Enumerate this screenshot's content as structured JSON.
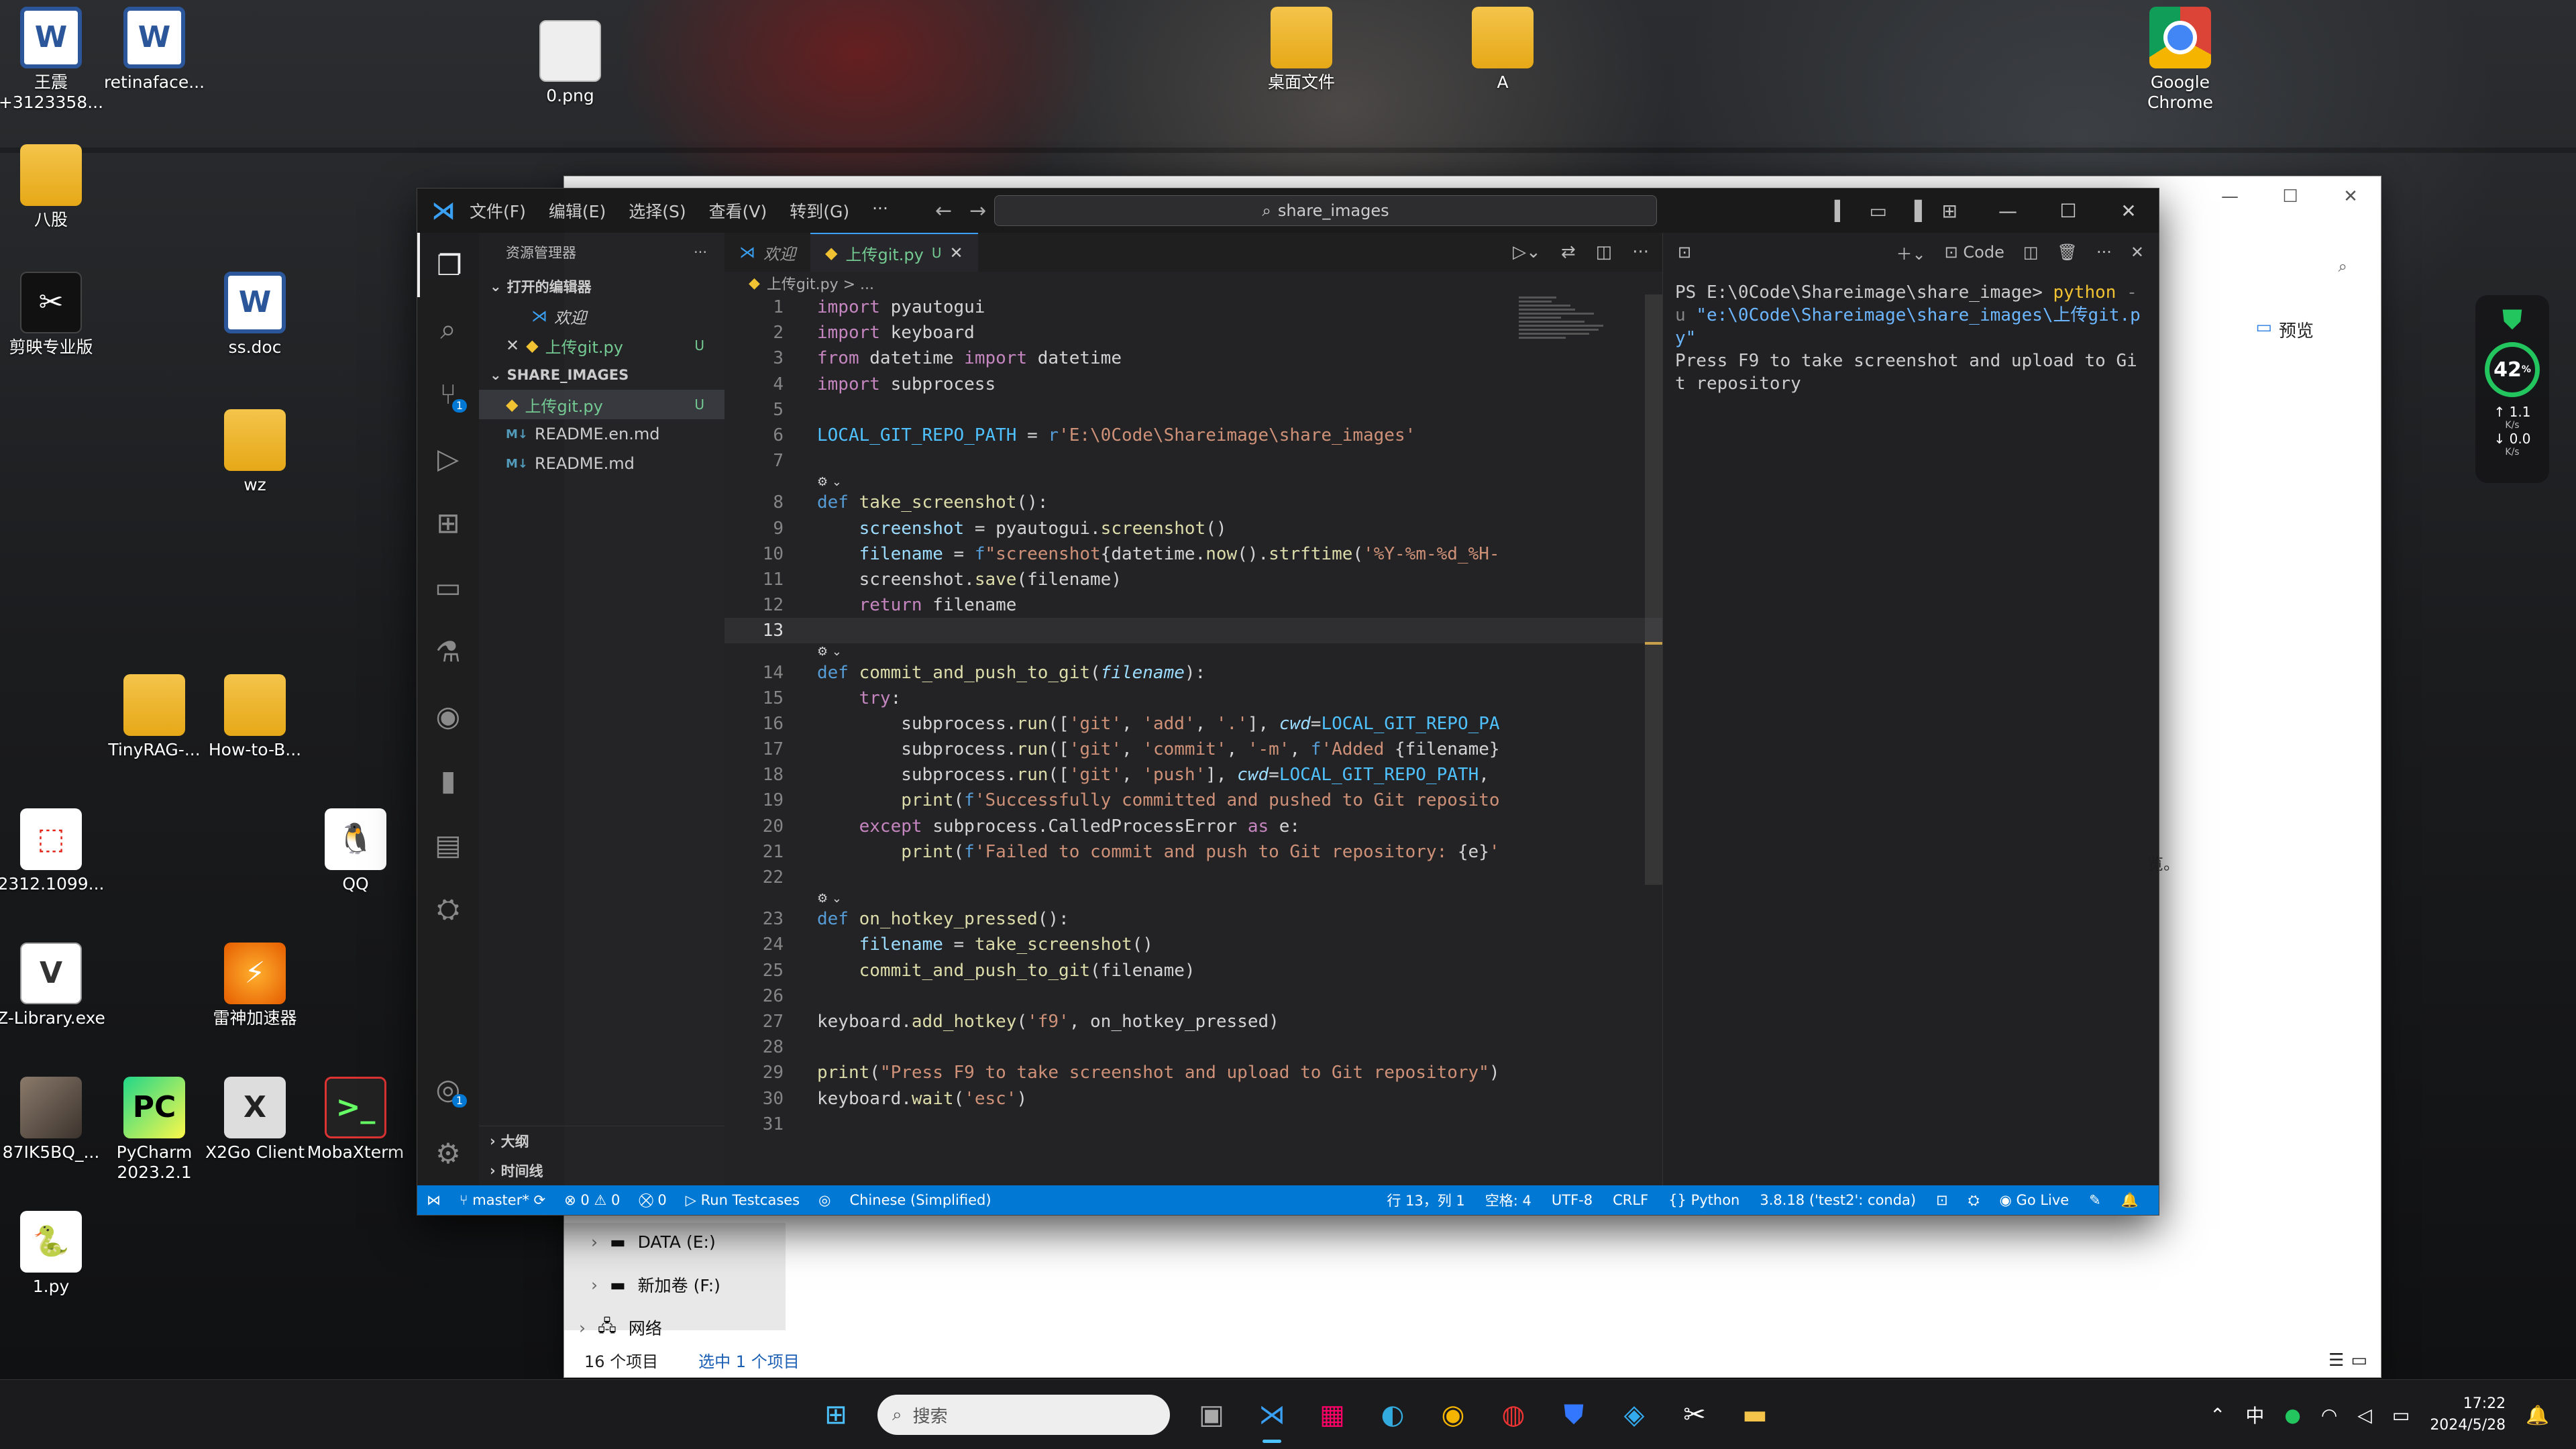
{
  "desktop": {
    "icons": [
      {
        "label": "王震\n+3123358...",
        "glyph": "W",
        "kind": "g-word"
      },
      {
        "label": "retinaface...",
        "glyph": "W",
        "kind": "g-word"
      },
      {
        "label": "0.png",
        "glyph": "",
        "kind": "g-img"
      },
      {
        "label": "桌面文件",
        "glyph": "",
        "kind": "g-folder"
      },
      {
        "label": "A",
        "glyph": "",
        "kind": "g-folder"
      },
      {
        "label": "Google\nChrome",
        "glyph": "",
        "kind": "g-chrome"
      },
      {
        "label": "八股",
        "glyph": "",
        "kind": "g-folder"
      },
      {
        "label": "剪映专业版",
        "glyph": "✂",
        "kind": "g-capcut"
      },
      {
        "label": "ss.doc",
        "glyph": "W",
        "kind": "g-word"
      },
      {
        "label": "wz",
        "glyph": "",
        "kind": "g-folder"
      },
      {
        "label": "TinyRAG-...",
        "glyph": "",
        "kind": "g-folder"
      },
      {
        "label": "How-to-B...",
        "glyph": "",
        "kind": "g-folder"
      },
      {
        "label": "2312.1099...",
        "glyph": "⬚",
        "kind": "g-pdf"
      },
      {
        "label": "QQ",
        "glyph": "🐧",
        "kind": "g-qq"
      },
      {
        "label": "Z-Library.exe",
        "glyph": "V",
        "kind": "g-lib"
      },
      {
        "label": "雷神加速器",
        "glyph": "⚡",
        "kind": "g-leishen"
      },
      {
        "label": "87IK5BQ_...",
        "glyph": "",
        "kind": "g-photo"
      },
      {
        "label": "PyCharm\n2023.2.1",
        "glyph": "PC",
        "kind": "g-pycharm"
      },
      {
        "label": "X2Go Client",
        "glyph": "X",
        "kind": "g-x2go"
      },
      {
        "label": "MobaXterm",
        "glyph": ">_",
        "kind": "g-moba"
      },
      {
        "label": "1.py",
        "glyph": "🐍",
        "kind": "g-py"
      }
    ]
  },
  "explorer": {
    "preview": "预览",
    "drives": [
      "DATA (E:)",
      "新加卷 (F:)",
      "网络"
    ],
    "status_count": "16 个项目",
    "status_selected": "选中 1 个项目",
    "tail_text": "览。"
  },
  "vscode": {
    "menu": [
      "文件(F)",
      "编辑(E)",
      "选择(S)",
      "查看(V)",
      "转到(G)",
      "···"
    ],
    "command_center": "share_images",
    "sidebar": {
      "title": "资源管理器",
      "open_editors": "打开的编辑器",
      "open_files": [
        {
          "name": "欢迎",
          "icon": "vs",
          "closeable": false
        },
        {
          "name": "上传git.py",
          "icon": "py",
          "closeable": true,
          "status": "U"
        }
      ],
      "folder": "SHARE_IMAGES",
      "files": [
        {
          "name": "上传git.py",
          "icon": "py",
          "status": "U"
        },
        {
          "name": "README.en.md",
          "icon": "md",
          "status": ""
        },
        {
          "name": "README.md",
          "icon": "md",
          "status": ""
        }
      ],
      "outline": "大纲",
      "timeline": "时间线"
    },
    "tabs": [
      {
        "label": "欢迎",
        "active": false
      },
      {
        "label": "上传git.py",
        "active": true,
        "status": "U"
      }
    ],
    "breadcrumb": "上传git.py > ...",
    "code_lines": [
      {
        "n": "1",
        "html": "<span class='kw'>import</span> pyautogui"
      },
      {
        "n": "2",
        "html": "<span class='kw'>import</span> keyboard"
      },
      {
        "n": "3",
        "html": "<span class='kw'>from</span> datetime <span class='kw'>import</span> datetime"
      },
      {
        "n": "4",
        "html": "<span class='kw'>import</span> subprocess"
      },
      {
        "n": "5",
        "html": ""
      },
      {
        "n": "6",
        "html": "<span class='cn'>LOCAL_GIT_REPO_PATH</span> = <span class='kb'>r</span><span class='st'>'E:\\0Code\\Shareimage\\share_images'</span>"
      },
      {
        "n": "7",
        "html": ""
      },
      {
        "n": "",
        "html": "⚙ ⌄",
        "lens": true
      },
      {
        "n": "8",
        "html": "<span class='kb'>def</span> <span class='fn'>take_screenshot</span>():"
      },
      {
        "n": "9",
        "html": "    <span class='va'>screenshot</span> = pyautogui.<span class='fn'>screenshot</span>()"
      },
      {
        "n": "10",
        "html": "    <span class='va'>filename</span> = <span class='kb'>f</span><span class='st'>\"screenshot</span>{datetime.<span class='fn'>now</span>().<span class='fn'>strftime</span>(<span class='st'>'%Y-%m-%d_%H-</span>"
      },
      {
        "n": "11",
        "html": "    screenshot.<span class='fn'>save</span>(filename)"
      },
      {
        "n": "12",
        "html": "    <span class='kw'>return</span> filename"
      },
      {
        "n": "13",
        "html": "",
        "current": true
      },
      {
        "n": "",
        "html": "⚙ ⌄",
        "lens": true
      },
      {
        "n": "14",
        "html": "<span class='kb'>def</span> <span class='fn'>commit_and_push_to_git</span>(<span class='pa'>filename</span>):"
      },
      {
        "n": "15",
        "html": "    <span class='kw'>try</span>:"
      },
      {
        "n": "16",
        "html": "        subprocess.<span class='fn'>run</span>([<span class='st'>'git'</span>, <span class='st'>'add'</span>, <span class='st'>'.'</span>], <span class='pa'>cwd</span>=<span class='cn'>LOCAL_GIT_REPO_PA</span>"
      },
      {
        "n": "17",
        "html": "        subprocess.<span class='fn'>run</span>([<span class='st'>'git'</span>, <span class='st'>'commit'</span>, <span class='st'>'-m'</span>, <span class='kb'>f</span><span class='st'>'Added </span>{filename}"
      },
      {
        "n": "18",
        "html": "        subprocess.<span class='fn'>run</span>([<span class='st'>'git'</span>, <span class='st'>'push'</span>], <span class='pa'>cwd</span>=<span class='cn'>LOCAL_GIT_REPO_PATH</span>,"
      },
      {
        "n": "19",
        "html": "        <span class='fn'>print</span>(<span class='kb'>f</span><span class='st'>'Successfully committed and pushed to Git reposito</span>"
      },
      {
        "n": "20",
        "html": "    <span class='kw'>except</span> subprocess.CalledProcessError <span class='kw'>as</span> e:"
      },
      {
        "n": "21",
        "html": "        <span class='fn'>print</span>(<span class='kb'>f</span><span class='st'>'Failed to commit and push to Git repository: </span>{e}<span class='st'>'</span>"
      },
      {
        "n": "22",
        "html": ""
      },
      {
        "n": "",
        "html": "⚙ ⌄",
        "lens": true
      },
      {
        "n": "23",
        "html": "<span class='kb'>def</span> <span class='fn'>on_hotkey_pressed</span>():"
      },
      {
        "n": "24",
        "html": "    <span class='va'>filename</span> = <span class='fn'>take_screenshot</span>()"
      },
      {
        "n": "25",
        "html": "    <span class='fn'>commit_and_push_to_git</span>(filename)"
      },
      {
        "n": "26",
        "html": ""
      },
      {
        "n": "27",
        "html": "keyboard.<span class='fn'>add_hotkey</span>(<span class='st'>'f9'</span>, on_hotkey_pressed)"
      },
      {
        "n": "28",
        "html": ""
      },
      {
        "n": "29",
        "html": "<span class='fn'>print</span>(<span class='st'>\"Press F9 to take screenshot and upload to Git repository\"</span>)"
      },
      {
        "n": "30",
        "html": "keyboard.<span class='fn'>wait</span>(<span class='st'>'esc'</span>)"
      },
      {
        "n": "31",
        "html": ""
      }
    ],
    "terminal": {
      "label": "Code",
      "prompt": "PS E:\\0Code\\Shareimage\\share_image>",
      "cmd": "python",
      "flag": "-u",
      "path": "\"e:\\0Code\\Shareimage\\share_images\\上传git.py\"",
      "output": "Press F9 to take screenshot and upload to Git repository"
    },
    "statusbar": {
      "branch": "master*",
      "errors": "⊗ 0 ⚠ 0",
      "ports": "⛒ 0",
      "run_testcases": "Run Testcases",
      "language_pack": "Chinese (Simplified)",
      "position": "行 13，列 1",
      "spaces": "空格: 4",
      "encoding": "UTF-8",
      "eol": "CRLF",
      "language": "Python",
      "interpreter": "3.8.18 ('test2': conda)",
      "golive": "Go Live"
    },
    "activity_badges": {
      "scm": "1",
      "accounts": "1"
    }
  },
  "netwidget": {
    "percent": "42",
    "percent_unit": "%",
    "up": "1.1",
    "down": "0.0",
    "unit": "K/s"
  },
  "taskbar": {
    "search_placeholder": "搜索",
    "ime": "中",
    "time": "17:22",
    "date": "2024/5/28"
  }
}
